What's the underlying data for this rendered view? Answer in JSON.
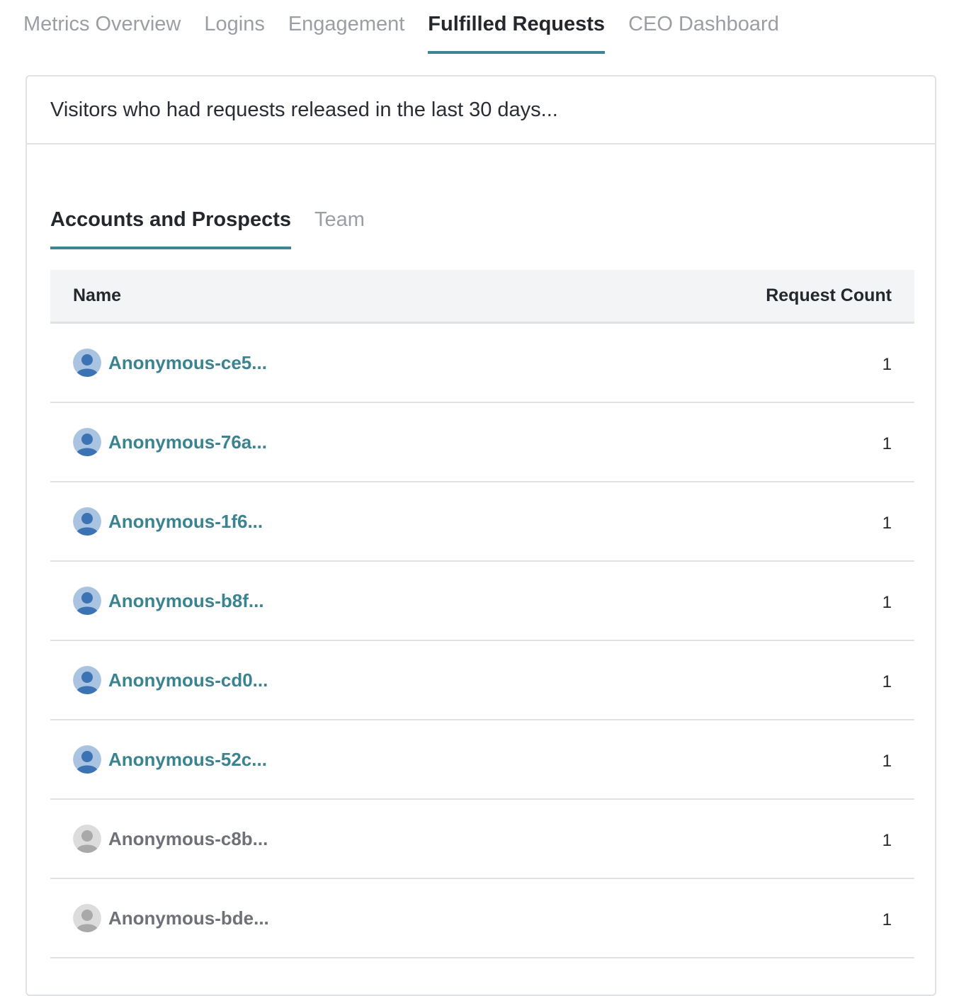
{
  "top_tabs": [
    {
      "label": "Metrics Overview",
      "active": false
    },
    {
      "label": "Logins",
      "active": false
    },
    {
      "label": "Engagement",
      "active": false
    },
    {
      "label": "Fulfilled Requests",
      "active": true
    },
    {
      "label": "CEO Dashboard",
      "active": false
    }
  ],
  "card": {
    "title": "Visitors who had requests released in the last 30 days...",
    "sub_tabs": [
      {
        "label": "Accounts and Prospects",
        "active": true
      },
      {
        "label": "Team",
        "active": false
      }
    ],
    "table": {
      "columns": {
        "name": "Name",
        "count": "Request Count"
      },
      "rows": [
        {
          "name": "Anonymous-ce5...",
          "count": "1",
          "status": "active"
        },
        {
          "name": "Anonymous-76a...",
          "count": "1",
          "status": "active"
        },
        {
          "name": "Anonymous-1f6...",
          "count": "1",
          "status": "active"
        },
        {
          "name": "Anonymous-b8f...",
          "count": "1",
          "status": "active"
        },
        {
          "name": "Anonymous-cd0...",
          "count": "1",
          "status": "active"
        },
        {
          "name": "Anonymous-52c...",
          "count": "1",
          "status": "active"
        },
        {
          "name": "Anonymous-c8b...",
          "count": "1",
          "status": "inactive"
        },
        {
          "name": "Anonymous-bde...",
          "count": "1",
          "status": "inactive"
        }
      ]
    }
  },
  "colors": {
    "accent": "#3e8593",
    "link_active": "#3a8391",
    "link_inactive": "#6e7178",
    "avatar_active_bg": "#a9c3e0",
    "avatar_active_fg": "#3b73b5",
    "avatar_inactive_bg": "#dcdcdc",
    "avatar_inactive_fg": "#a9a9a9"
  },
  "icons": {
    "avatar": "user-avatar-icon"
  }
}
